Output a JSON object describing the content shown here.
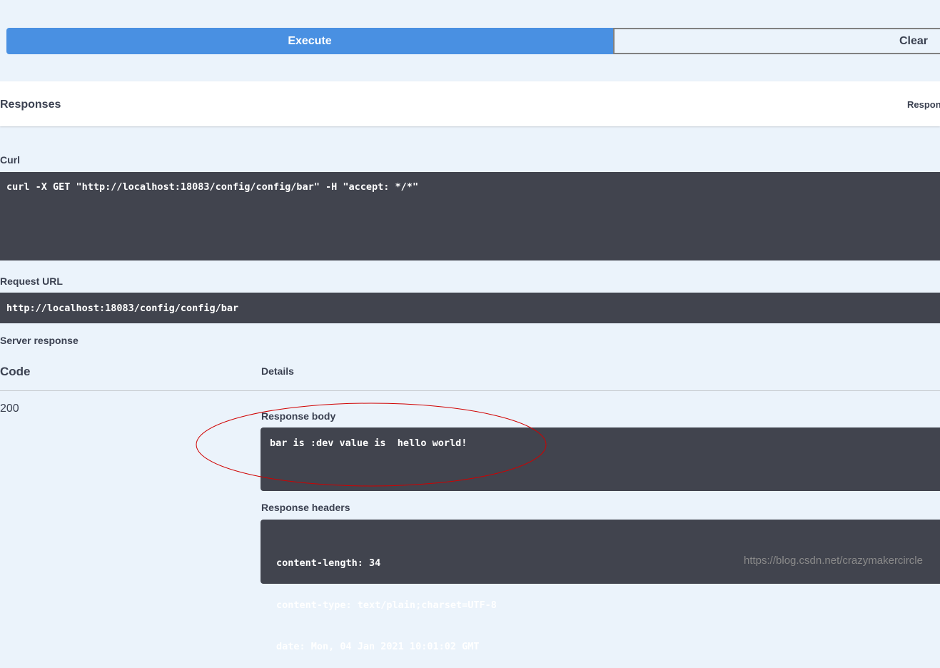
{
  "actions": {
    "execute_label": "Execute",
    "clear_label": "Clear"
  },
  "responses": {
    "title": "Responses",
    "content_type_label": "Respon"
  },
  "curl": {
    "label": "Curl",
    "command": "curl -X GET \"http://localhost:18083/config/config/bar\" -H \"accept: */*\""
  },
  "request_url": {
    "label": "Request URL",
    "value": "http://localhost:18083/config/config/bar"
  },
  "server_response": {
    "label": "Server response",
    "columns": {
      "code": "Code",
      "details": "Details"
    },
    "status_code": "200",
    "body_label": "Response body",
    "body": "bar is :dev value is  hello world!",
    "headers_label": "Response headers",
    "headers": [
      "content-length: 34",
      "content-type: text/plain;charset=UTF-8",
      "date: Mon, 04 Jan 2021 10:01:02 GMT"
    ]
  },
  "watermark": "https://blog.csdn.net/crazymakercircle",
  "colors": {
    "accent": "#4990e2",
    "code_bg": "#41444e",
    "page_bg": "#ebf3fb",
    "annotation": "#d00000"
  }
}
